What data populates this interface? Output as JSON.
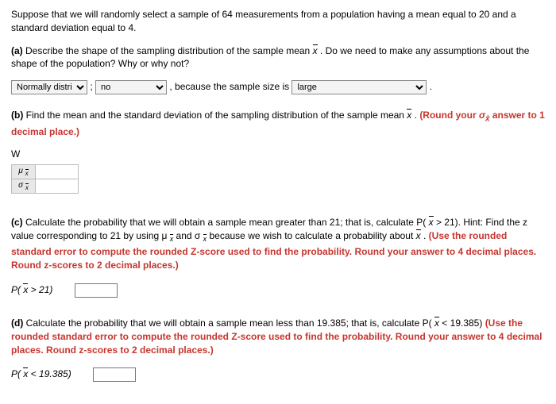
{
  "intro": "Suppose that we will randomly select a sample of 64 measurements from a population having a mean equal to 20 and a standard deviation equal to 4.",
  "partA": {
    "label": "(a)",
    "text1": "Describe the shape of the sampling distribution of the sample mean ",
    "text2": " . Do we need to make any assumptions about the shape of the population? Why or why not?",
    "shapeOptions": [
      "Normally distri"
    ],
    "shapeSelected": "Normally distri",
    "colon": ";",
    "assumeOptions": [
      "no"
    ],
    "assumeSelected": "no",
    "reasonPrefix": ", because the sample size is ",
    "reasonOptions": [
      "large"
    ],
    "reasonSelected": "large",
    "period": "."
  },
  "partB": {
    "label": "(b)",
    "text1": "Find the mean and the standard deviation of the sampling distribution of the sample mean ",
    "text2": " . ",
    "roundNote": "(Round your σₓ answer to 1 decimal place.)",
    "w": "W",
    "row1Label": "μ x̄",
    "row2Label": "σ x̄",
    "row1Value": "",
    "row2Value": ""
  },
  "partC": {
    "label": "(c)",
    "text1": "Calculate the probability that we will obtain a sample mean greater than 21; that is, calculate P( ",
    "text2": "  > 21). Hint: Find the z value corresponding to 21 by using μ ",
    "text3": " and σ ",
    "text4": " because we wish to calculate a probability about ",
    "text5": " . ",
    "redNote": "(Use the rounded standard error to compute the rounded Z-score used to find the probability. Round your answer to 4 decimal places. Round z-scores to 2 decimal places.)",
    "probLabel": "P( x̄ > 21)",
    "probValue": ""
  },
  "partD": {
    "label": "(d)",
    "text1": "Calculate the probability that we will obtain a sample mean less than 19.385; that is, calculate P( ",
    "text2": " < 19.385) ",
    "redNote": "(Use the rounded standard error to compute the rounded Z-score used to find the probability. Round your answer to 4 decimal places. Round z-scores to 2 decimal places.)",
    "probLabel": "P( x̄ < 19.385)",
    "probValue": ""
  }
}
